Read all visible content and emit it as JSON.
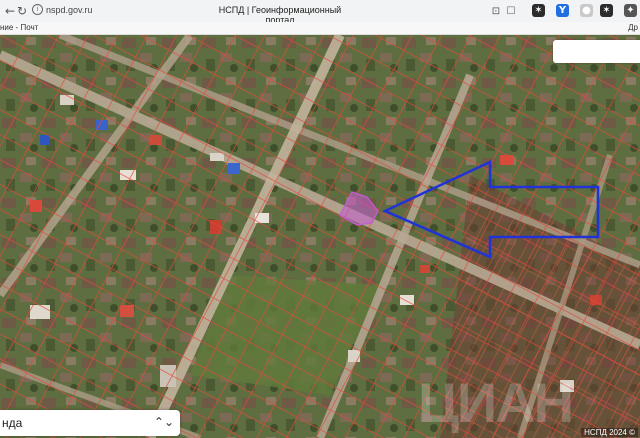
{
  "browser": {
    "url": "nspd.gov.ru",
    "title": "НСПД | Геоинформационный портал",
    "extensions": [
      {
        "name": "ext-wand-icon",
        "color": "#2b2b2b",
        "glyph": "✶"
      },
      {
        "name": "ext-yandex-icon",
        "color": "#1f6fe0",
        "glyph": "Y"
      },
      {
        "name": "ext-record-icon",
        "color": "#c9c9c9",
        "glyph": "●"
      },
      {
        "name": "ext-wand2-icon",
        "color": "#2b2b2b",
        "glyph": "✶"
      },
      {
        "name": "ext-puzzle-icon",
        "color": "#555555",
        "glyph": "✦"
      }
    ]
  },
  "bookmarks": {
    "left": "ние - Почт",
    "right": "Др"
  },
  "map": {
    "layer_select": "нда",
    "chevron": "⌃⌄",
    "watermark": "ЦИАН",
    "copyright": "НСПД 2024 ©",
    "colors": {
      "parcel_border": "#e2493c",
      "selected_parcel": "#c65bd6",
      "arrow": "#2233d6",
      "road": "#b8a894"
    }
  }
}
